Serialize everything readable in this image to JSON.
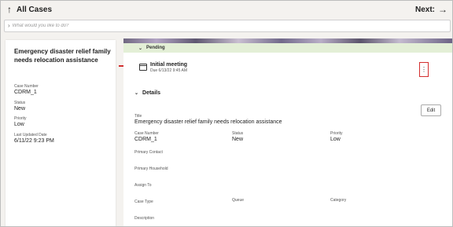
{
  "header": {
    "back_icon": "arrow-up-icon",
    "back_label": "All Cases",
    "next_label": "Next:",
    "next_icon": "arrow-right-icon"
  },
  "search": {
    "icon": "chevron-right-icon",
    "placeholder": "What would you like to do?"
  },
  "summary": {
    "title": "Emergency disaster relief family needs relocation assistance",
    "fields": [
      {
        "label": "Case Number",
        "value": "CDRM_1"
      },
      {
        "label": "Status",
        "value": "New"
      },
      {
        "label": "Priority",
        "value": "Low"
      },
      {
        "label": "Last Updated Date",
        "value": "6/11/22 9:23 PM"
      }
    ]
  },
  "pending": {
    "label": "Pending",
    "task": {
      "icon": "calendar-icon",
      "name": "Initial meeting",
      "due": "Due 6/13/22 9:45 AM"
    },
    "menu_icon": "more-vertical-icon"
  },
  "details": {
    "label": "Details",
    "edit_label": "Edit",
    "title_label": "Title",
    "title_value": "Emergency disaster relief family needs relocation assistance",
    "case_number_label": "Case Number",
    "case_number_value": "CDRM_1",
    "status_label": "Status",
    "status_value": "New",
    "priority_label": "Priority",
    "priority_value": "Low",
    "primary_contact_label": "Primary Contact",
    "primary_household_label": "Primary Household",
    "assign_to_label": "Assign To",
    "case_type_label": "Case Type",
    "queue_label": "Queue",
    "category_label": "Category",
    "description_label": "Description"
  },
  "colors": {
    "highlight": "#d32f2f",
    "pending_bg": "#e3efd6"
  }
}
